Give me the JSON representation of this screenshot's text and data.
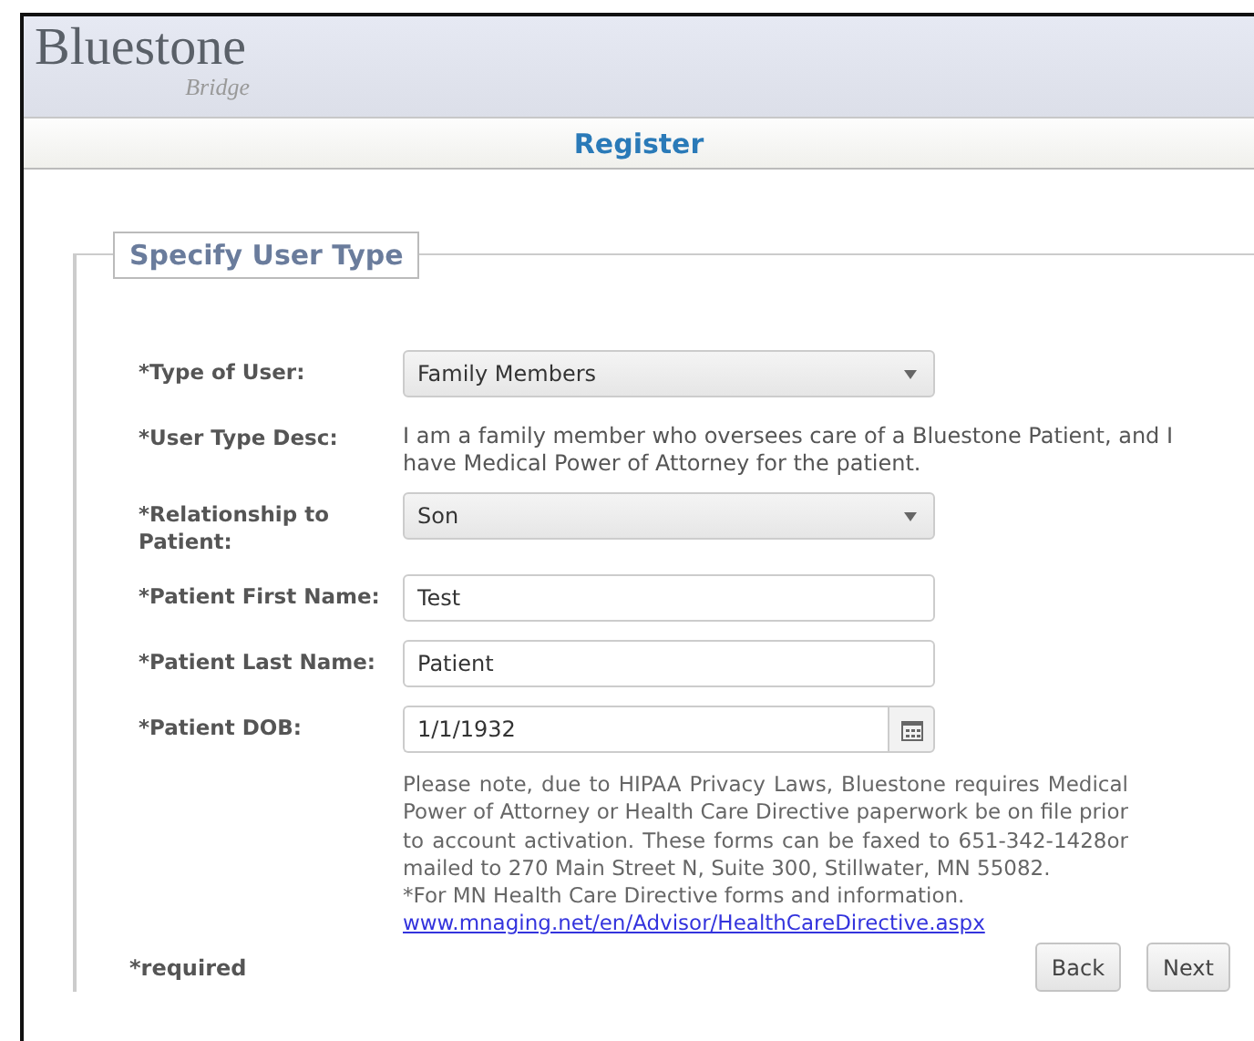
{
  "logo": {
    "name": "Bluestone",
    "sub": "Bridge"
  },
  "page_title": "Register",
  "fieldset": {
    "legend": "Specify User Type",
    "fields": [
      {
        "kind": "select",
        "label": "*Type of User:",
        "value": "Family Members"
      },
      {
        "kind": "desc",
        "label": "*User Type Desc:",
        "value": "I am a family member who oversees care of a Bluestone Patient, and I have Medical Power of Attorney for the patient."
      },
      {
        "kind": "select",
        "label": "*Relationship to Patient:",
        "value": "Son"
      },
      {
        "kind": "text",
        "label": "*Patient First Name:",
        "value": "Test"
      },
      {
        "kind": "text",
        "label": "*Patient Last Name:",
        "value": "Patient"
      },
      {
        "kind": "date",
        "label": "*Patient DOB:",
        "value": "1/1/1932"
      }
    ],
    "note": "Please note, due to HIPAA Privacy Laws, Bluestone requires Medical Power of Attorney or Health Care Directive paperwork be on file prior to account activation. These forms can be faxed to 651-342-1428or mailed to 270 Main Street N, Suite 300, Stillwater, MN 55082.",
    "note_2": "*For MN Health Care Directive forms and information.",
    "link": "www.mnaging.net/en/Advisor/HealthCareDirective.aspx",
    "required": "*required",
    "buttons": [
      "Back",
      "Next"
    ]
  }
}
